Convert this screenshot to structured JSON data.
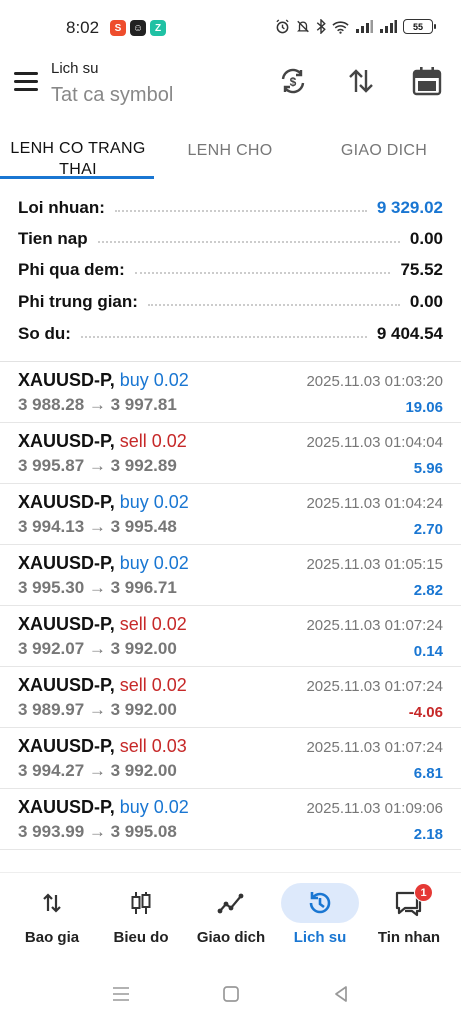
{
  "status": {
    "time": "8:02",
    "battery": "55",
    "apps": [
      {
        "icon": "shopee-app-icon",
        "color": "#ee4d2d",
        "glyph": "S"
      },
      {
        "icon": "messenger-app-icon",
        "color": "#222222",
        "glyph": "☺"
      },
      {
        "icon": "zalo-app-icon",
        "color": "#20c1a4",
        "glyph": "Z"
      }
    ]
  },
  "header": {
    "title": "Lich su",
    "subtitle": "Tat ca symbol"
  },
  "tabs": [
    {
      "label": "LENH CO TRANG THAI",
      "active": true
    },
    {
      "label": "LENH CHO",
      "active": false
    },
    {
      "label": "GIAO DICH",
      "active": false
    }
  ],
  "summary": [
    {
      "label": "Loi nhuan:",
      "value": "9 329.02",
      "highlight": true
    },
    {
      "label": "Tien nap",
      "value": "0.00",
      "highlight": false
    },
    {
      "label": "Phi qua dem:",
      "value": "75.52",
      "highlight": false
    },
    {
      "label": "Phi trung gian:",
      "value": "0.00",
      "highlight": false
    },
    {
      "label": "So du:",
      "value": "9 404.54",
      "highlight": false
    }
  ],
  "trades": [
    {
      "symbol": "XAUUSD-P,",
      "side": "buy",
      "volume": "buy 0.02",
      "prices": "3 988.28 → 3 997.81",
      "time": "2025.11.03 01:03:20",
      "profit": "19.06"
    },
    {
      "symbol": "XAUUSD-P,",
      "side": "sell",
      "volume": "sell 0.02",
      "prices": "3 995.87 → 3 992.89",
      "time": "2025.11.03 01:04:04",
      "profit": "5.96"
    },
    {
      "symbol": "XAUUSD-P,",
      "side": "buy",
      "volume": "buy 0.02",
      "prices": "3 994.13 → 3 995.48",
      "time": "2025.11.03 01:04:24",
      "profit": "2.70"
    },
    {
      "symbol": "XAUUSD-P,",
      "side": "buy",
      "volume": "buy 0.02",
      "prices": "3 995.30 → 3 996.71",
      "time": "2025.11.03 01:05:15",
      "profit": "2.82"
    },
    {
      "symbol": "XAUUSD-P,",
      "side": "sell",
      "volume": "sell 0.02",
      "prices": "3 992.07 → 3 992.00",
      "time": "2025.11.03 01:07:24",
      "profit": "0.14"
    },
    {
      "symbol": "XAUUSD-P,",
      "side": "sell",
      "volume": "sell 0.02",
      "prices": "3 989.97 → 3 992.00",
      "time": "2025.11.03 01:07:24",
      "profit": "-4.06"
    },
    {
      "symbol": "XAUUSD-P,",
      "side": "sell",
      "volume": "sell 0.03",
      "prices": "3 994.27 → 3 992.00",
      "time": "2025.11.03 01:07:24",
      "profit": "6.81"
    },
    {
      "symbol": "XAUUSD-P,",
      "side": "buy",
      "volume": "buy 0.02",
      "prices": "3 993.99 → 3 995.08",
      "time": "2025.11.03 01:09:06",
      "profit": "2.18"
    }
  ],
  "nav": [
    {
      "label": "Bao gia",
      "icon": "quotes-icon",
      "active": false
    },
    {
      "label": "Bieu do",
      "icon": "chart-icon",
      "active": false
    },
    {
      "label": "Giao dich",
      "icon": "trade-icon",
      "active": false
    },
    {
      "label": "Lich su",
      "icon": "history-icon",
      "active": true
    },
    {
      "label": "Tin nhan",
      "icon": "messages-icon",
      "active": false,
      "badge": "1"
    }
  ],
  "colors": {
    "accent": "#1976d2",
    "loss": "#c62828"
  }
}
